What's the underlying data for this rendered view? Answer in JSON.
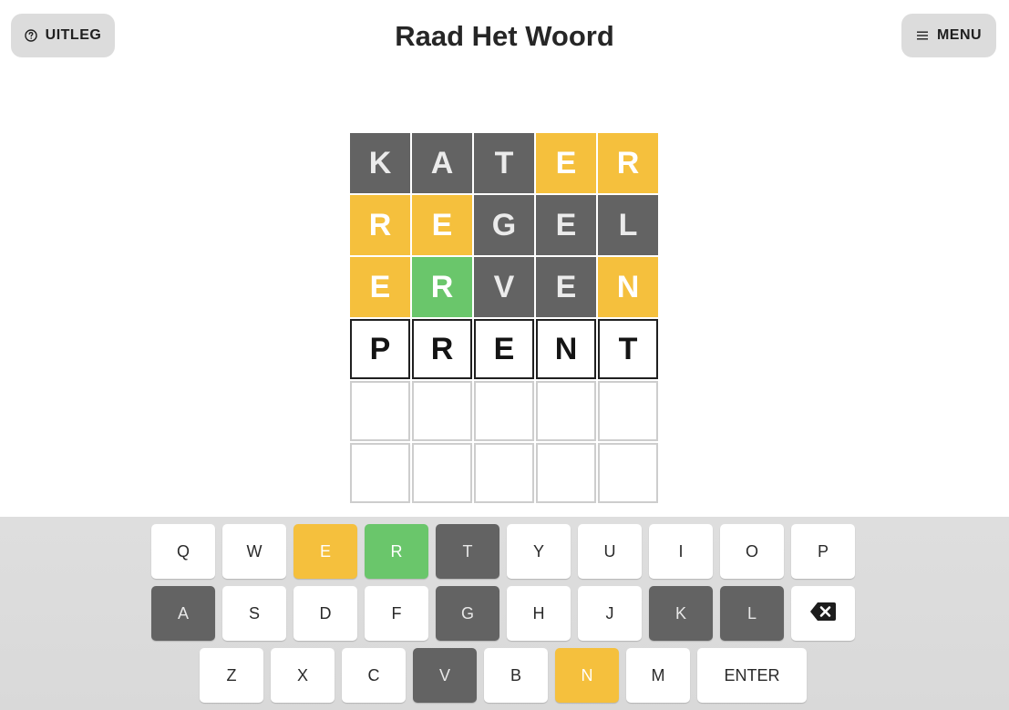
{
  "header": {
    "title": "Raad Het Woord",
    "help_label": "UITLEG",
    "menu_label": "MENU",
    "help_icon": "question-circle-icon",
    "menu_icon": "hamburger-icon"
  },
  "colors": {
    "absent": "#636363",
    "present": "#f5c03d",
    "correct": "#6ac66b"
  },
  "board": {
    "rows": [
      [
        {
          "letter": "K",
          "state": "absent"
        },
        {
          "letter": "A",
          "state": "absent"
        },
        {
          "letter": "T",
          "state": "absent"
        },
        {
          "letter": "E",
          "state": "present"
        },
        {
          "letter": "R",
          "state": "present"
        }
      ],
      [
        {
          "letter": "R",
          "state": "present"
        },
        {
          "letter": "E",
          "state": "present"
        },
        {
          "letter": "G",
          "state": "absent"
        },
        {
          "letter": "E",
          "state": "absent"
        },
        {
          "letter": "L",
          "state": "absent"
        }
      ],
      [
        {
          "letter": "E",
          "state": "present"
        },
        {
          "letter": "R",
          "state": "correct"
        },
        {
          "letter": "V",
          "state": "absent"
        },
        {
          "letter": "E",
          "state": "absent"
        },
        {
          "letter": "N",
          "state": "present"
        }
      ],
      [
        {
          "letter": "P",
          "state": "typed"
        },
        {
          "letter": "R",
          "state": "typed"
        },
        {
          "letter": "E",
          "state": "typed"
        },
        {
          "letter": "N",
          "state": "typed"
        },
        {
          "letter": "T",
          "state": "typed"
        }
      ],
      [
        {
          "letter": "",
          "state": "empty"
        },
        {
          "letter": "",
          "state": "empty"
        },
        {
          "letter": "",
          "state": "empty"
        },
        {
          "letter": "",
          "state": "empty"
        },
        {
          "letter": "",
          "state": "empty"
        }
      ],
      [
        {
          "letter": "",
          "state": "empty"
        },
        {
          "letter": "",
          "state": "empty"
        },
        {
          "letter": "",
          "state": "empty"
        },
        {
          "letter": "",
          "state": "empty"
        },
        {
          "letter": "",
          "state": "empty"
        }
      ]
    ]
  },
  "keyboard": {
    "rows": [
      [
        {
          "label": "Q",
          "state": ""
        },
        {
          "label": "W",
          "state": ""
        },
        {
          "label": "E",
          "state": "present"
        },
        {
          "label": "R",
          "state": "correct"
        },
        {
          "label": "T",
          "state": "absent"
        },
        {
          "label": "Y",
          "state": ""
        },
        {
          "label": "U",
          "state": ""
        },
        {
          "label": "I",
          "state": ""
        },
        {
          "label": "O",
          "state": ""
        },
        {
          "label": "P",
          "state": ""
        }
      ],
      [
        {
          "label": "A",
          "state": "absent"
        },
        {
          "label": "S",
          "state": ""
        },
        {
          "label": "D",
          "state": ""
        },
        {
          "label": "F",
          "state": ""
        },
        {
          "label": "G",
          "state": "absent"
        },
        {
          "label": "H",
          "state": ""
        },
        {
          "label": "J",
          "state": ""
        },
        {
          "label": "K",
          "state": "absent"
        },
        {
          "label": "L",
          "state": "absent"
        },
        {
          "label": "",
          "state": "",
          "icon": "backspace-icon"
        }
      ],
      [
        {
          "label": "Z",
          "state": ""
        },
        {
          "label": "X",
          "state": ""
        },
        {
          "label": "C",
          "state": ""
        },
        {
          "label": "V",
          "state": "absent"
        },
        {
          "label": "B",
          "state": ""
        },
        {
          "label": "N",
          "state": "present"
        },
        {
          "label": "M",
          "state": ""
        },
        {
          "label": "ENTER",
          "state": "",
          "wide": true
        }
      ]
    ]
  }
}
